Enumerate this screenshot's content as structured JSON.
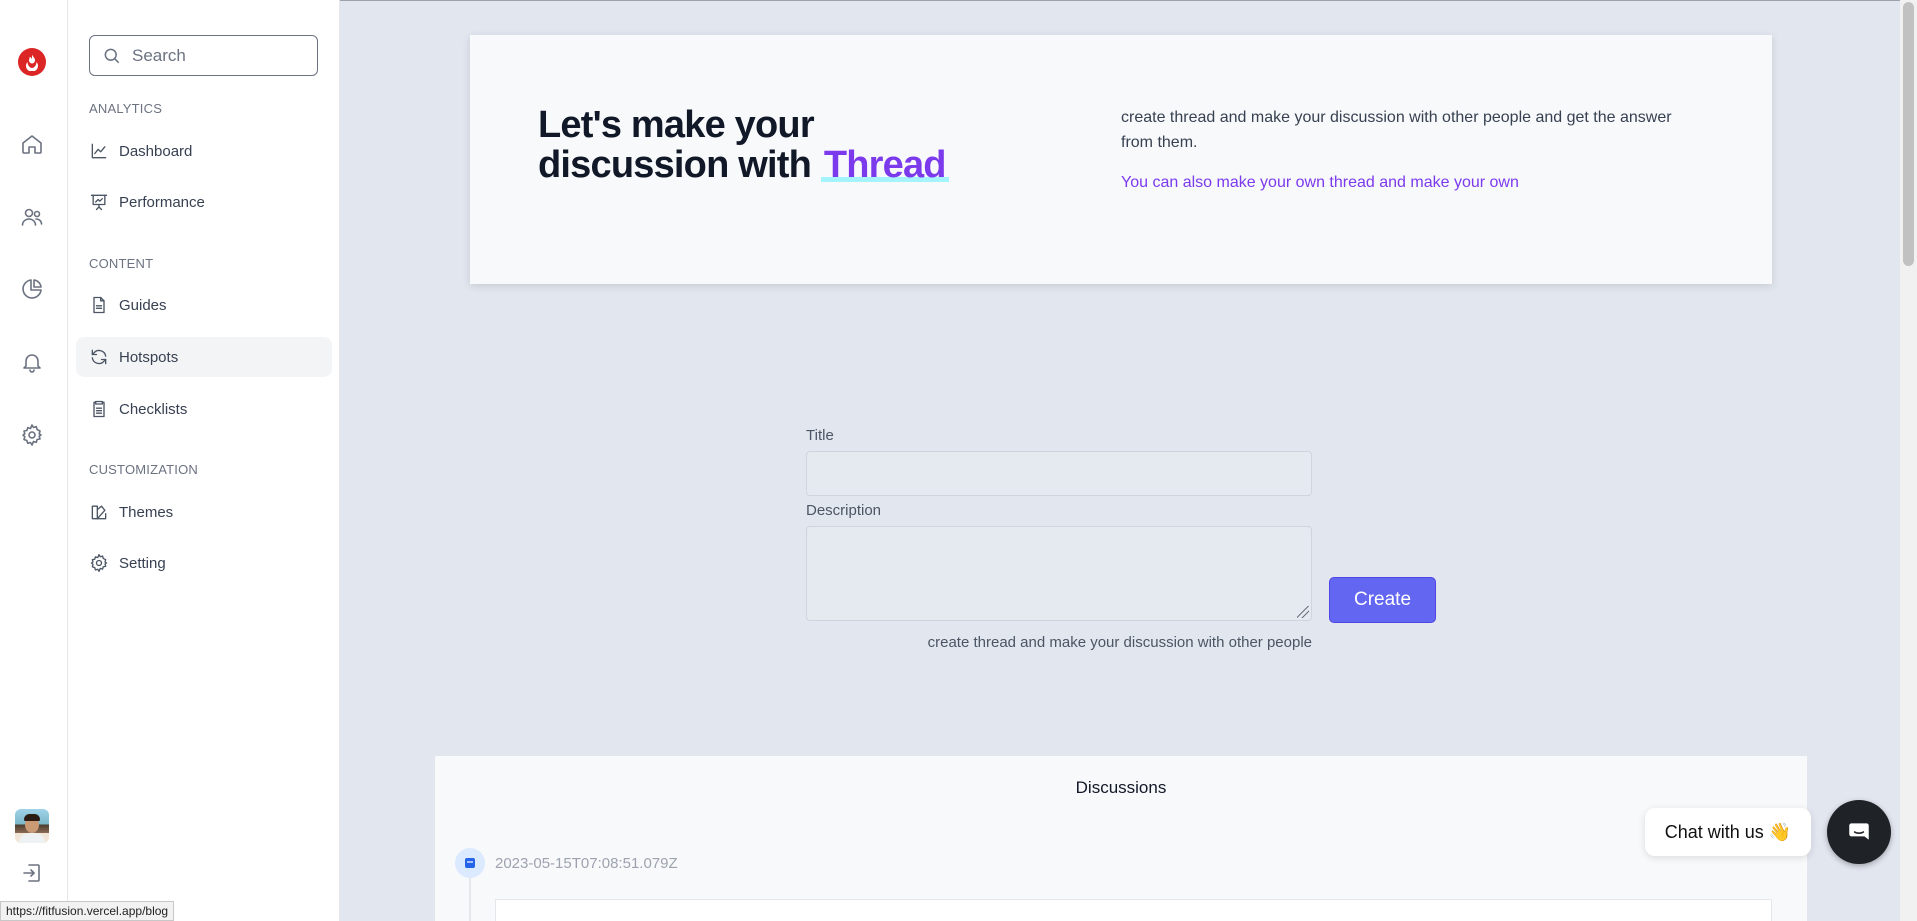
{
  "sidebar": {
    "search_placeholder": "Search",
    "sections": [
      {
        "title": "ANALYTICS"
      },
      {
        "title": "CONTENT"
      },
      {
        "title": "CUSTOMIZATION"
      }
    ],
    "items": [
      {
        "label": "Dashboard"
      },
      {
        "label": "Performance"
      },
      {
        "label": "Guides"
      },
      {
        "label": "Hotspots",
        "active": true
      },
      {
        "label": "Checklists"
      },
      {
        "label": "Themes"
      },
      {
        "label": "Setting"
      }
    ]
  },
  "hero": {
    "title_line1": "Let's make your",
    "title_line2": "discussion with",
    "title_accent": "Thread",
    "description": "create thread and make your discussion with other people and get the answer from them.",
    "subtext": "You can also make your own thread and make your own"
  },
  "form": {
    "title_label": "Title",
    "title_value": "",
    "description_label": "Description",
    "description_value": "",
    "create_button": "Create",
    "hint": "create thread and make your discussion with other people"
  },
  "discussions": {
    "heading": "Discussions",
    "items": [
      {
        "timestamp": "2023-05-15T07:08:51.079Z"
      }
    ]
  },
  "chat": {
    "label": "Chat with us 👋"
  },
  "status_bar": {
    "url": "https://fitfusion.vercel.app/blog"
  },
  "colors": {
    "accent": "#7c3aed",
    "button": "#6366f1",
    "logo": "#dc2626"
  }
}
